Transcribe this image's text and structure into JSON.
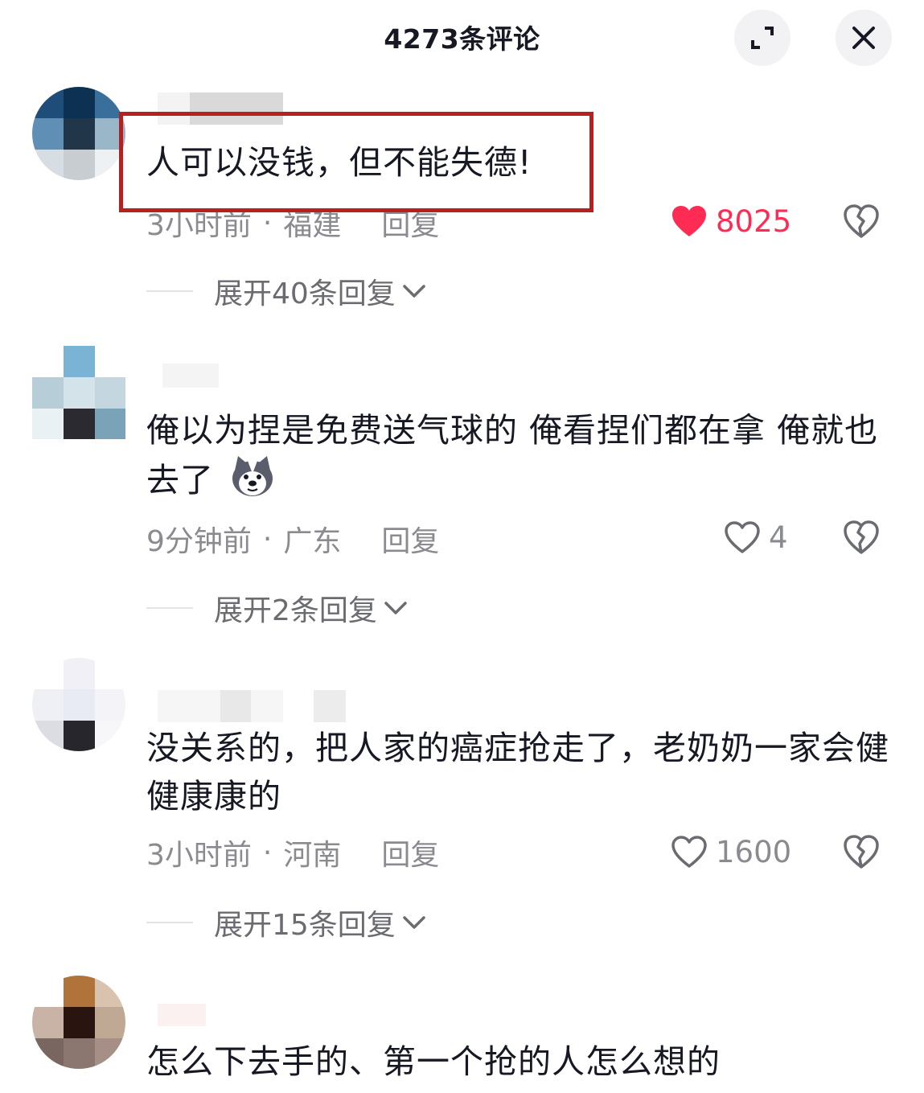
{
  "header": {
    "title": "4273条评论",
    "expand_icon": "expand-icon",
    "close_icon": "close-icon"
  },
  "comments": [
    {
      "text": "人可以没钱，但不能失德!",
      "time": "3小时前",
      "location": "福建",
      "reply_label": "回复",
      "likes": "8025",
      "liked": true,
      "expand_label": "展开40条回复"
    },
    {
      "text": "俺以为捏是免费送气球的 俺看捏们都在拿 俺就也去了",
      "emoji": "husky-emoji",
      "time": "9分钟前",
      "location": "广东",
      "reply_label": "回复",
      "likes": "4",
      "liked": false,
      "expand_label": "展开2条回复"
    },
    {
      "text": "没关系的，把人家的癌症抢走了，老奶奶一家会健健康康的",
      "time": "3小时前",
      "location": "河南",
      "reply_label": "回复",
      "likes": "1600",
      "liked": false,
      "expand_label": "展开15条回复"
    },
    {
      "text": "怎么下去手的、第一个抢的人怎么想的"
    }
  ],
  "colors": {
    "accent_like": "#fe2c55",
    "highlight_box": "#b8201d",
    "meta_text": "#8a8b91"
  }
}
